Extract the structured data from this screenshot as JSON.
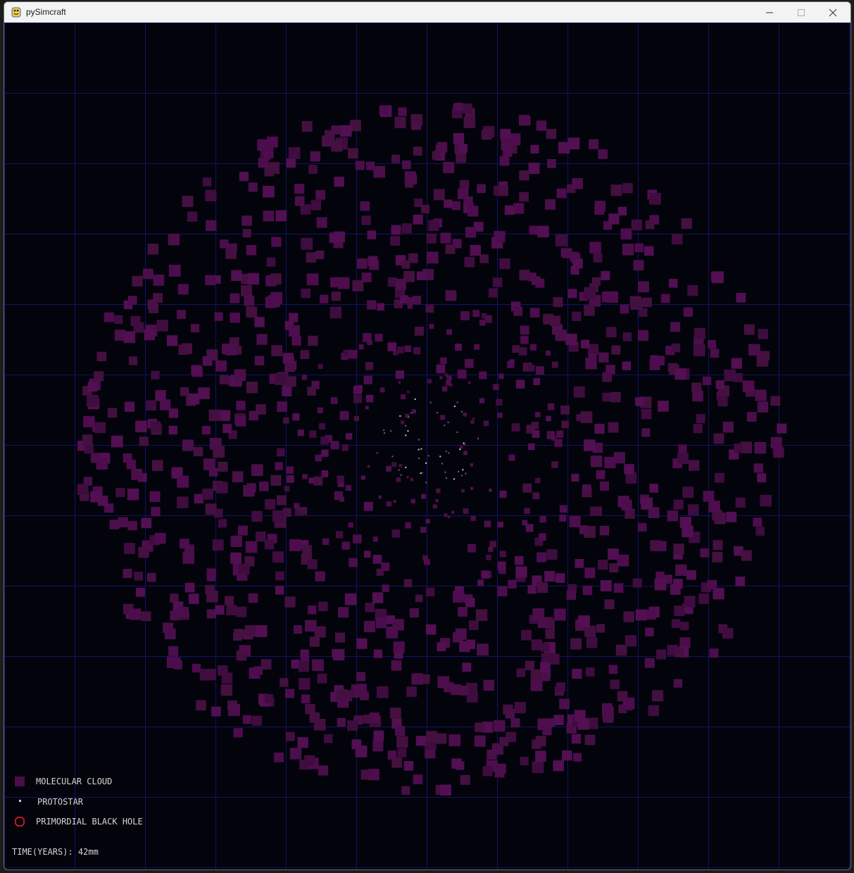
{
  "window": {
    "title": "pySimcraft",
    "controls": {
      "minimize": "minimize-icon",
      "maximize": "maximize-icon",
      "close": "close-icon"
    }
  },
  "simulation": {
    "background_color": "#03030b",
    "grid_color": "#12126a",
    "cloud_color": "#4a0f4a",
    "protostar_color": "#d0c8e0",
    "black_hole_color": "#ff2020"
  },
  "legend": {
    "molecular_cloud": "MOLECULAR CLOUD",
    "protostar": "PROTOSTAR",
    "primordial_black_hole": "PRIMORDIAL BLACK HOLE"
  },
  "status": {
    "time_label": "TIME(YEARS): 42mm"
  }
}
